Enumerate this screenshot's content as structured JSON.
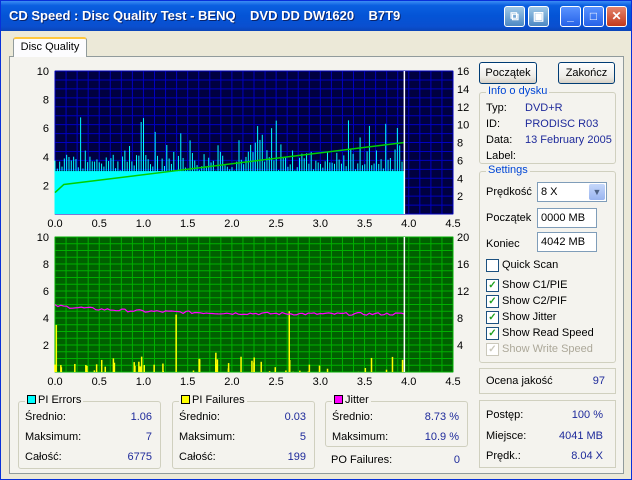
{
  "window": {
    "title": "CD Speed : Disc Quality Test - BENQ    DVD DD DW1620    B7T9",
    "minimize": "_",
    "maximize": "□",
    "close": "✕"
  },
  "tabs": [
    {
      "label": "Disc Quality"
    }
  ],
  "buttons": {
    "start": "Początek",
    "end": "Zakończ"
  },
  "disc_info": {
    "title": "Info o dysku",
    "rows": [
      {
        "label": "Typ:",
        "value": "DVD+R"
      },
      {
        "label": "ID:",
        "value": "PRODISC R03"
      },
      {
        "label": "Data:",
        "value": "13 February 2005"
      },
      {
        "label": "Label:",
        "value": ""
      }
    ]
  },
  "settings": {
    "title": "Settings",
    "speed_label": "Prędkość",
    "speed_value": "8 X",
    "start_label": "Początek",
    "start_value": "0000 MB",
    "end_label": "Koniec",
    "end_value": "4042 MB",
    "checkboxes": [
      {
        "label": "Quick Scan",
        "checked": false,
        "disabled": false
      },
      {
        "label": "Show C1/PIE",
        "checked": true,
        "disabled": false
      },
      {
        "label": "Show C2/PIF",
        "checked": true,
        "disabled": false
      },
      {
        "label": "Show Jitter",
        "checked": true,
        "disabled": false
      },
      {
        "label": "Show Read Speed",
        "checked": true,
        "disabled": false
      },
      {
        "label": "Show Write Speed",
        "checked": true,
        "disabled": true
      }
    ]
  },
  "quality": {
    "label": "Ocena jakość",
    "value": "97"
  },
  "progress": {
    "rows": [
      {
        "label": "Postęp:",
        "value": "100 %"
      },
      {
        "label": "Miejsce:",
        "value": "4041 MB"
      },
      {
        "label": "Prędk.:",
        "value": "8.04 X"
      }
    ]
  },
  "stats": {
    "pi_errors": {
      "title": "PI Errors",
      "color": "#00ffff",
      "rows": [
        {
          "label": "Średnio:",
          "value": "1.06"
        },
        {
          "label": "Maksimum:",
          "value": "7"
        },
        {
          "label": "Całość:",
          "value": "6775"
        }
      ]
    },
    "pi_failures": {
      "title": "PI Failures",
      "color": "#ffff00",
      "rows": [
        {
          "label": "Średnio:",
          "value": "0.03"
        },
        {
          "label": "Maksimum:",
          "value": "5"
        },
        {
          "label": "Całość:",
          "value": "199"
        }
      ]
    },
    "jitter": {
      "title": "Jitter",
      "color": "#ff00ff",
      "rows": [
        {
          "label": "Średnio:",
          "value": "8.73 %"
        },
        {
          "label": "Maksimum:",
          "value": "10.9 %"
        }
      ]
    },
    "po_failures": {
      "label": "PO Failures:",
      "value": "0"
    }
  },
  "chart_data": [
    {
      "type": "bar",
      "title": "",
      "colors": {
        "background": "#000040",
        "grid": "#0000c0",
        "bars": "#00ffff",
        "speed_line": "#00d000"
      },
      "x_ticks": [
        "0.0",
        "0.5",
        "1.0",
        "1.5",
        "2.0",
        "2.5",
        "3.0",
        "3.5",
        "4.0",
        "4.5"
      ],
      "xlim": [
        0,
        4.5
      ],
      "y_ticks_left": [
        "2",
        "4",
        "6",
        "8",
        "10"
      ],
      "ylim_left": [
        0,
        10
      ],
      "y_ticks_right": [
        "2",
        "4",
        "6",
        "8",
        "10",
        "12",
        "14",
        "16"
      ],
      "ylim_right": [
        0,
        16
      ],
      "series": [
        {
          "name": "PI Errors",
          "baseline": 3,
          "max": 7,
          "end_x": 3.95
        },
        {
          "name": "Read Speed",
          "x": [
            0.0,
            0.1,
            3.95
          ],
          "y": [
            2.4,
            3.3,
            8.0
          ]
        }
      ],
      "end_marker_x": 3.95
    },
    {
      "type": "bar",
      "title": "",
      "colors": {
        "background": "#006000",
        "grid": "#00b000",
        "bars": "#ffff00",
        "jitter_line": "#ff00ff"
      },
      "x_ticks": [
        "0.0",
        "0.5",
        "1.0",
        "1.5",
        "2.0",
        "2.5",
        "3.0",
        "3.5",
        "4.0",
        "4.5"
      ],
      "xlim": [
        0,
        4.5
      ],
      "y_ticks_left": [
        "2",
        "4",
        "6",
        "8",
        "10"
      ],
      "ylim_left": [
        0,
        10
      ],
      "y_ticks_right": [
        "4",
        "8",
        "12",
        "16",
        "20"
      ],
      "ylim_right": [
        0,
        20
      ],
      "series": [
        {
          "name": "PI Failures",
          "max": 5,
          "end_x": 3.95
        },
        {
          "name": "Jitter",
          "x": [
            0.0,
            0.5,
            1.0,
            2.0,
            3.0,
            3.95
          ],
          "y": [
            9.8,
            9.3,
            9.0,
            8.7,
            8.6,
            8.6
          ]
        }
      ],
      "end_marker_x": 3.95
    }
  ]
}
